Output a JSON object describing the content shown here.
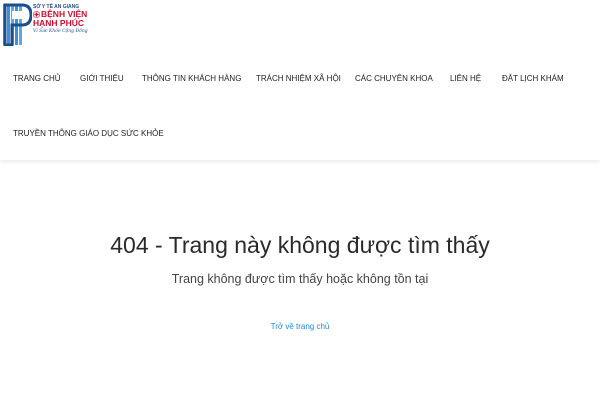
{
  "logo": {
    "line1": "SỞ Y TẾ AN GIANG",
    "line2": "BỆNH VIỆN",
    "line3": "HẠNH PHÚC",
    "slogan": "Vì Sức Khỏe Cộng Đồng",
    "colors": {
      "blue": "#1b4d8f",
      "red": "#c8102e",
      "light_blue": "#5aa9e6"
    }
  },
  "nav": {
    "items": [
      {
        "label": "TRANG CHỦ"
      },
      {
        "label": "GIỚI THIỆU"
      },
      {
        "label": "THÔNG TIN KHÁCH HÀNG"
      },
      {
        "label": "TRÁCH NHIỆM XÃ HỘI"
      },
      {
        "label": "CÁC CHUYÊN KHOA"
      },
      {
        "label": "LIÊN HỆ"
      },
      {
        "label": "ĐẶT LỊCH KHÁM"
      },
      {
        "label": "TRUYỀN THÔNG GIÁO DỤC SỨC KHỎE"
      }
    ]
  },
  "error": {
    "title": "404 - Trang này không được tìm thấy",
    "subtitle": "Trang không được tìm thấy hoặc không tồn tại",
    "home_link": "Trở về trang chủ",
    "link_color": "#1e88e5"
  }
}
